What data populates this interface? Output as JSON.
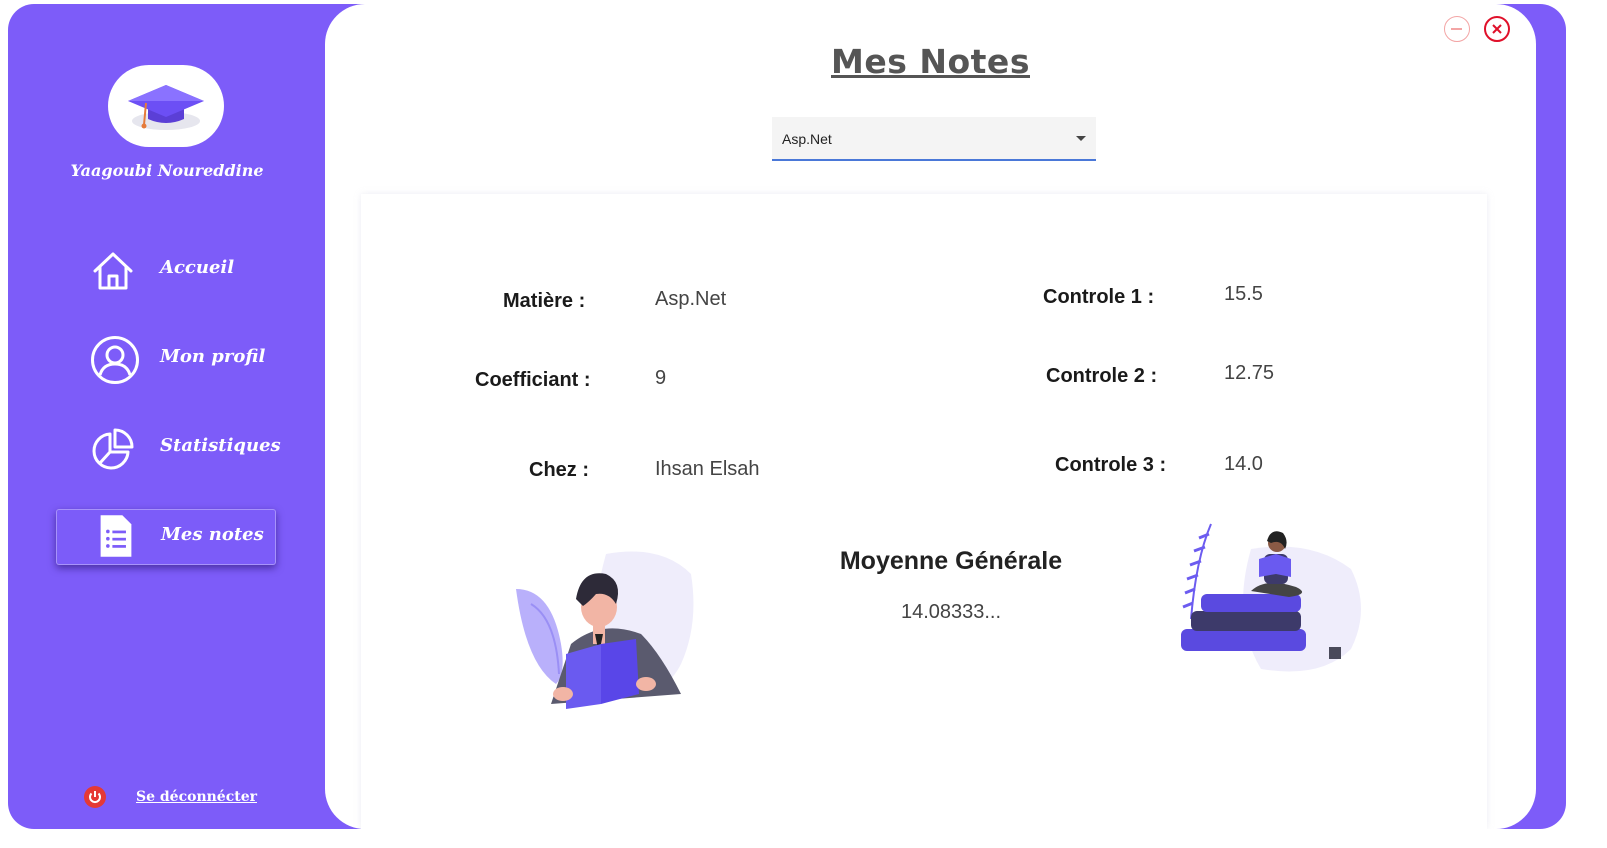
{
  "sidebar": {
    "user_name": "Yaagoubi Noureddine",
    "items": [
      {
        "label": "Accueil",
        "icon": "home-icon"
      },
      {
        "label": "Mon profil",
        "icon": "user-circle-icon"
      },
      {
        "label": "Statistiques",
        "icon": "pie-chart-icon"
      },
      {
        "label": "Mes notes",
        "icon": "document-list-icon",
        "active": true
      }
    ],
    "logout_label": "Se déconnécter"
  },
  "header": {
    "title": "Mes Notes"
  },
  "subject_select": {
    "selected": "Asp.Net"
  },
  "details": {
    "matiere_label": "Matière :",
    "matiere_value": "Asp.Net",
    "coef_label": "Coefficiant :",
    "coef_value": "9",
    "chez_label": "Chez :",
    "chez_value": "Ihsan Elsah",
    "c1_label": "Controle 1 :",
    "c1_value": "15.5",
    "c2_label": "Controle 2 :",
    "c2_value": "12.75",
    "c3_label": "Controle 3 :",
    "c3_value": "14.0"
  },
  "average": {
    "label": "Moyenne Générale",
    "value": "14.08333..."
  },
  "colors": {
    "accent": "#7d5cf9",
    "close": "#e0102a"
  }
}
